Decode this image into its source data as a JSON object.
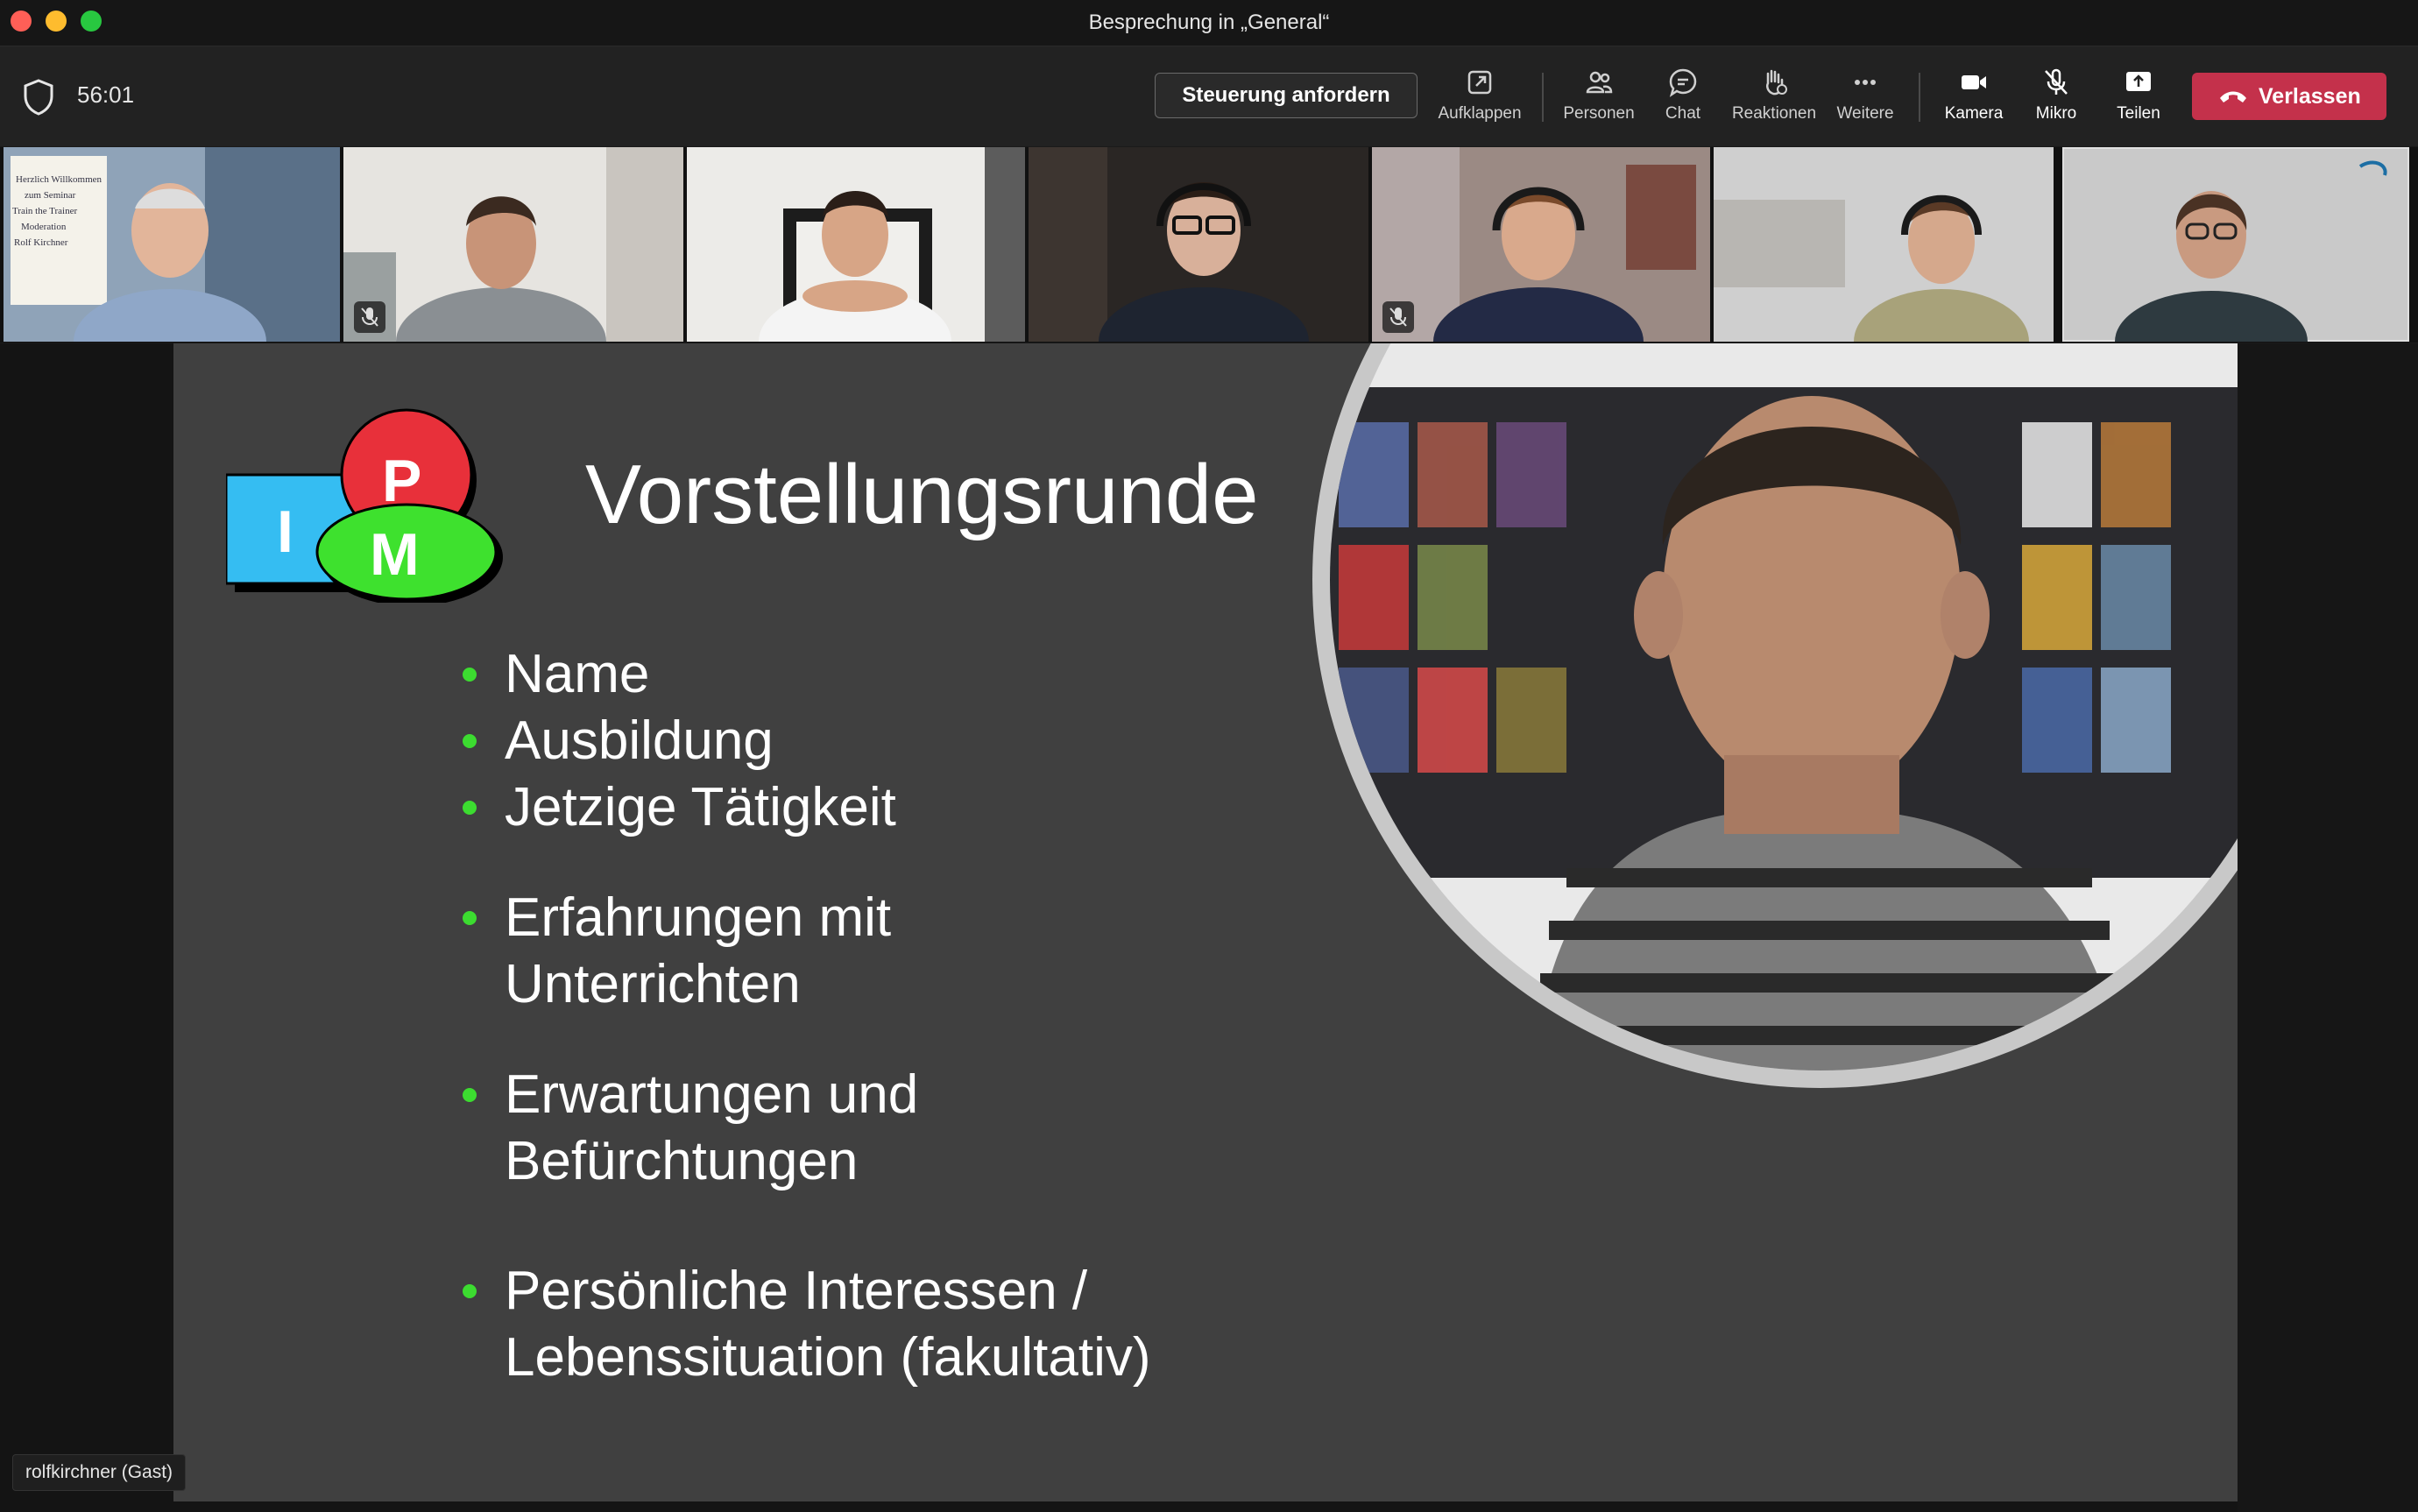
{
  "window": {
    "title": "Besprechung in „General“"
  },
  "meeting": {
    "timer": "56:01",
    "request_control_label": "Steuerung anfordern",
    "toolbar": [
      {
        "id": "popout",
        "label": "Aufklappen",
        "icon": "popout-icon"
      },
      {
        "id": "people",
        "label": "Personen",
        "icon": "people-icon"
      },
      {
        "id": "chat",
        "label": "Chat",
        "icon": "chat-icon"
      },
      {
        "id": "reactions",
        "label": "Reaktionen",
        "icon": "reaction-hand-icon"
      },
      {
        "id": "more",
        "label": "Weitere",
        "icon": "more-dots-icon"
      },
      {
        "id": "camera",
        "label": "Kamera",
        "icon": "camera-icon"
      },
      {
        "id": "mic",
        "label": "Mikro",
        "icon": "mic-off-icon"
      },
      {
        "id": "share",
        "label": "Teilen",
        "icon": "share-screen-icon"
      }
    ],
    "leave_label": "Verlassen"
  },
  "participants": [
    {
      "active": true,
      "muted": false
    },
    {
      "active": false,
      "muted": true
    },
    {
      "active": false,
      "muted": false
    },
    {
      "active": false,
      "muted": false
    },
    {
      "active": false,
      "muted": true
    },
    {
      "active": false,
      "muted": false
    },
    {
      "active": false,
      "muted": false
    }
  ],
  "whiteboard_text": [
    "Herzlich Willkommen",
    "zum Seminar",
    "Train the Trainer",
    "Moderation",
    "Rolf Kirchner"
  ],
  "slide": {
    "logo_letters": {
      "p": "P",
      "i": "I",
      "m": "M"
    },
    "title": "Vorstellungsrunde",
    "bullets": [
      "Name",
      "Ausbildung",
      "Jetzige Tätigkeit",
      "Erfahrungen mit Unterrichten",
      "Erwartungen und Befürchtungen",
      "Persönliche Interessen / Lebenssituation (fakultativ)"
    ]
  },
  "presenter_label": "rolfkirchner (Gast)",
  "colors": {
    "leave": "#c4314b",
    "active_border": "#8b86d6",
    "bullet": "#3cdc30",
    "logo_red": "#e8303a",
    "logo_blue": "#35bdf2",
    "logo_green": "#3ee12e"
  }
}
